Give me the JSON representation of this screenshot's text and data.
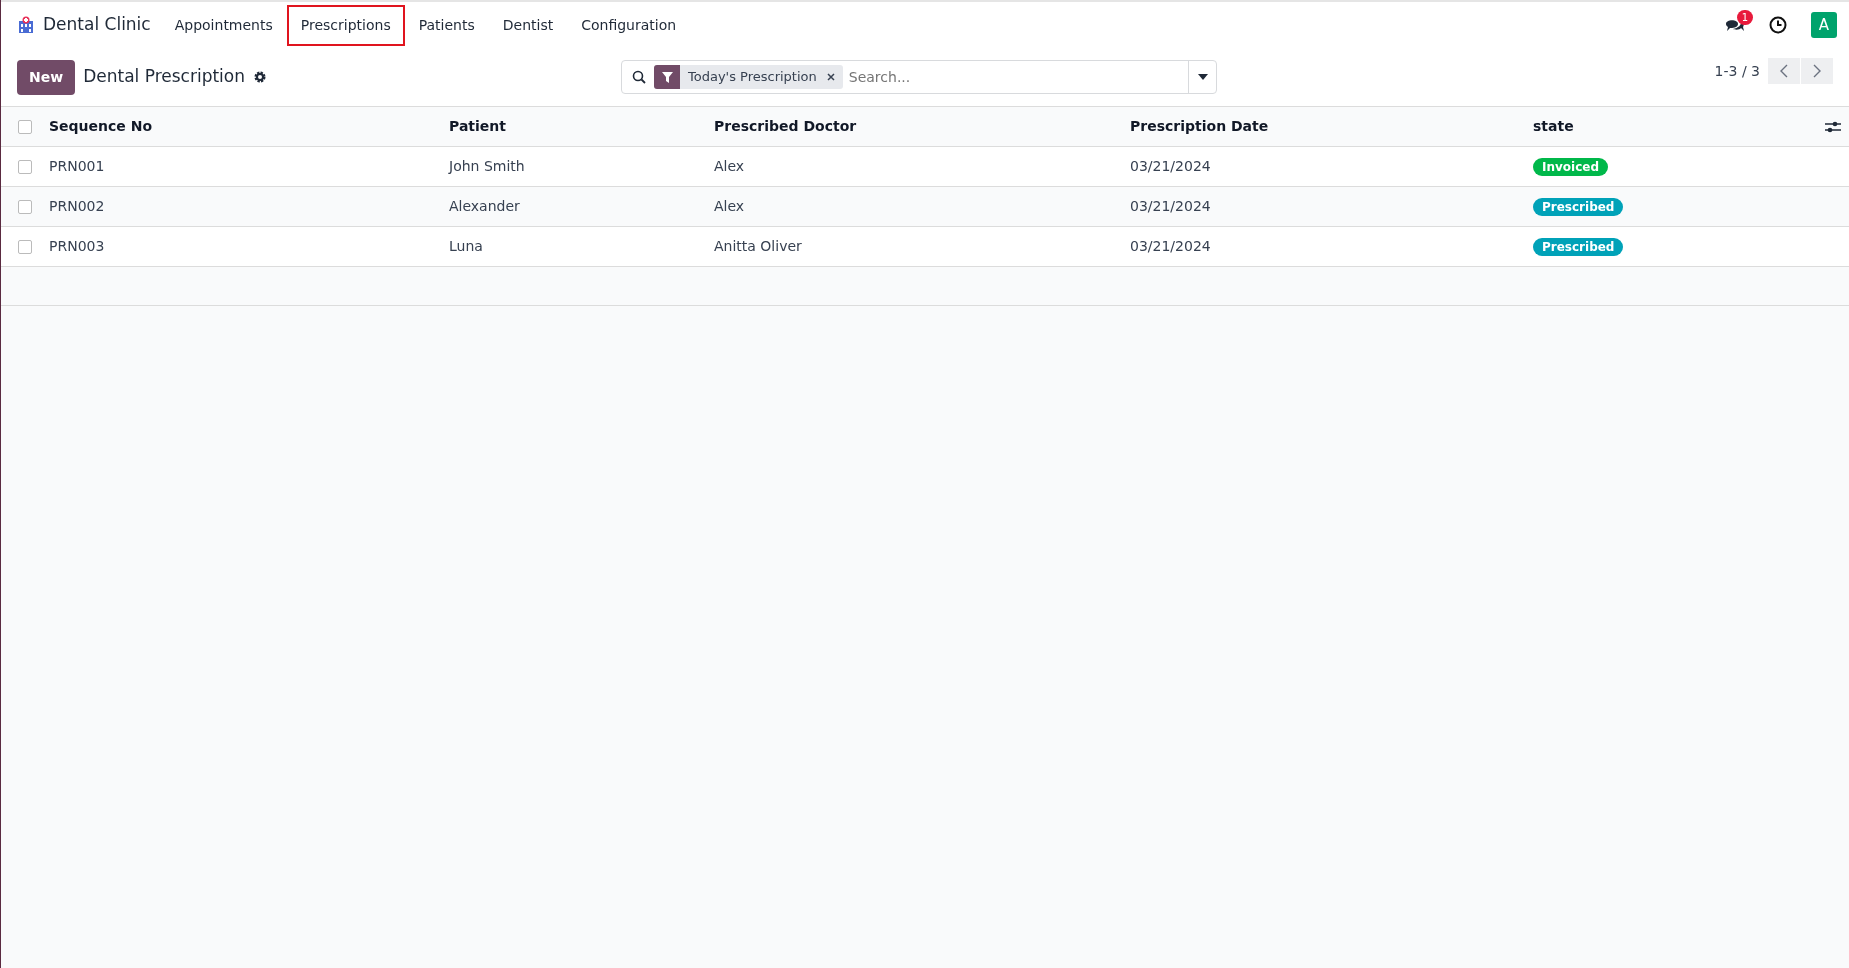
{
  "navbar": {
    "app_name": "Dental Clinic",
    "menu": [
      {
        "label": "Appointments",
        "highlighted": false
      },
      {
        "label": "Prescriptions",
        "highlighted": true
      },
      {
        "label": "Patients",
        "highlighted": false
      },
      {
        "label": "Dentist",
        "highlighted": false
      },
      {
        "label": "Configuration",
        "highlighted": false
      }
    ],
    "messages_badge": "1",
    "avatar": "A"
  },
  "control_panel": {
    "new_button": "New",
    "title": "Dental Prescription",
    "search": {
      "facets": [
        "Today's Prescription"
      ],
      "placeholder": "Search..."
    },
    "pager": "1-3 / 3"
  },
  "table": {
    "select_all_checked": false,
    "columns": [
      "Sequence No",
      "Patient",
      "Prescribed Doctor",
      "Prescription Date",
      "state"
    ],
    "rows": [
      {
        "cells": [
          "PRN001",
          "John Smith",
          "Alex",
          "03/21/2024"
        ],
        "state": "Invoiced",
        "color": "#00b84a",
        "checked": false
      },
      {
        "cells": [
          "PRN002",
          "Alexander",
          "Alex",
          "03/21/2024"
        ],
        "state": "Prescribed",
        "color": "#00a2b8",
        "checked": false
      },
      {
        "cells": [
          "PRN003",
          "Luna",
          "Anitta Oliver",
          "03/21/2024"
        ],
        "state": "Prescribed",
        "color": "#00a2b8",
        "checked": false
      }
    ]
  }
}
